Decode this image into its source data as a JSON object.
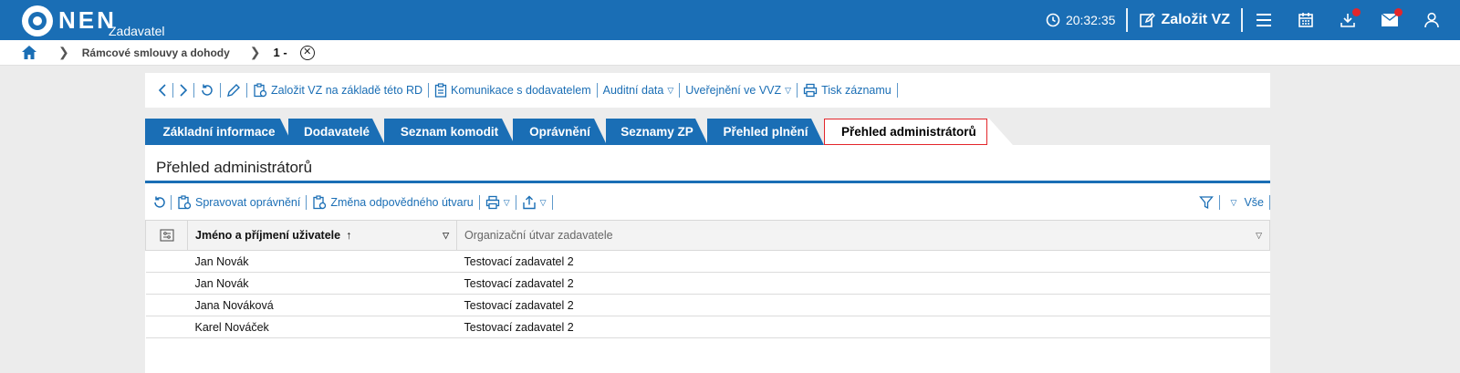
{
  "header": {
    "logo_text": "NEN",
    "logo_sub": "Zadavatel",
    "time": "20:32:35",
    "create_label": "Založit VZ"
  },
  "breadcrumb": {
    "item1": "Rámcové smlouvy a dohody",
    "current": "1 -"
  },
  "toolbar": {
    "create_from_rd": "Založit VZ na základě této RD",
    "communication": "Komunikace s dodavatelem",
    "audit": "Auditní data",
    "publish": "Uveřejnění ve VVZ",
    "print": "Tisk záznamu"
  },
  "tabs": [
    {
      "label": "Základní informace"
    },
    {
      "label": "Dodavatelé"
    },
    {
      "label": "Seznam komodit"
    },
    {
      "label": "Oprávnění"
    },
    {
      "label": "Seznamy ZP"
    },
    {
      "label": "Přehled plnění"
    },
    {
      "label": "Přehled administrátorů"
    }
  ],
  "panel": {
    "title": "Přehled administrátorů",
    "manage_permissions": "Spravovat oprávnění",
    "change_unit": "Změna odpovědného útvaru",
    "filter_all": "Vše"
  },
  "grid": {
    "columns": [
      "Jméno a příjmení uživatele",
      "Organizační útvar zadavatele"
    ],
    "rows": [
      {
        "name": "Jan Novák",
        "unit": "Testovací zadavatel 2"
      },
      {
        "name": "Jan Novák",
        "unit": "Testovací zadavatel 2"
      },
      {
        "name": "Jana Nováková",
        "unit": "Testovací zadavatel 2"
      },
      {
        "name": "Karel Nováček",
        "unit": "Testovací zadavatel 2"
      }
    ]
  },
  "colors": {
    "brand": "#1a6eb5",
    "alert": "#e3262b"
  }
}
